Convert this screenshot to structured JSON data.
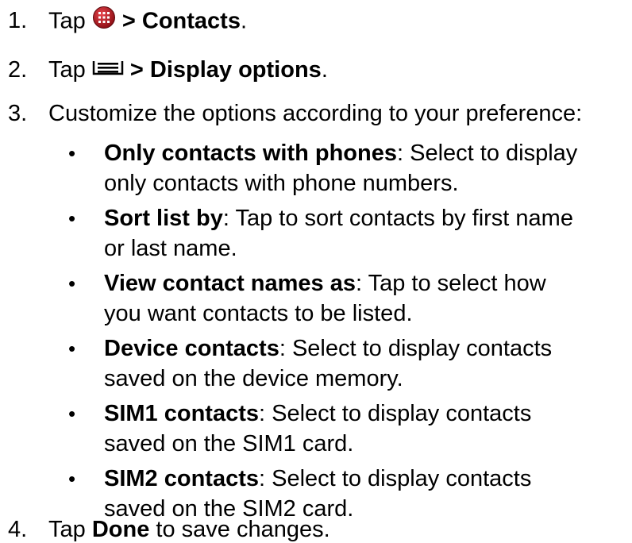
{
  "steps": [
    {
      "number": "1.",
      "text_pre": "Tap",
      "icon": "apps-grid-icon",
      "bold": "> Contacts",
      "text_post": "."
    },
    {
      "number": "2.",
      "text_pre": "Tap",
      "icon": "menu-icon",
      "bold": "> Display options",
      "text_post": "."
    },
    {
      "number": "3.",
      "text": "Customize the options according to your preference:"
    },
    {
      "number": "4.",
      "text_pre": "Tap ",
      "bold": "Done",
      "text_post": " to save changes."
    }
  ],
  "options": [
    {
      "term": "Only contacts with phones",
      "line1": ": Select to display",
      "line2": "only contacts with phone numbers."
    },
    {
      "term": "Sort list by",
      "line1": ": Tap to sort contacts by first name",
      "line2": "or last name."
    },
    {
      "term": "View contact names as",
      "line1": ": Tap to select how",
      "line2": "you want contacts to be listed."
    },
    {
      "term": "Device contacts",
      "line1": ": Select to display contacts",
      "line2": "saved on the device memory."
    },
    {
      "term": "SIM1 contacts",
      "line1": ": Select to display contacts",
      "line2": "saved on the SIM1 card."
    },
    {
      "term": "SIM2 contacts",
      "line1": ": Select to display contacts",
      "line2": "saved on the SIM2 card."
    }
  ],
  "bullet_char": "•",
  "colors": {
    "text": "#000000",
    "icon_red": "#b5161e"
  }
}
